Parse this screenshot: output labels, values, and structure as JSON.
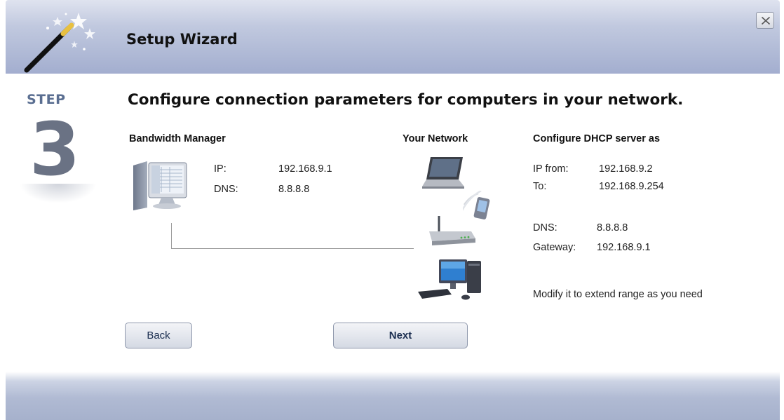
{
  "window": {
    "title": "Setup Wizard"
  },
  "step": {
    "label": "STEP",
    "number": "3"
  },
  "heading": "Configure connection parameters for computers in your network.",
  "bandwidth_manager": {
    "title": "Bandwidth Manager",
    "ip_label": "IP:",
    "ip_value": "192.168.9.1",
    "dns_label": "DNS:",
    "dns_value": "8.8.8.8"
  },
  "your_network": {
    "title": "Your Network"
  },
  "dhcp": {
    "title": "Configure DHCP server as",
    "ip_from_label": "IP from:",
    "ip_from_value": "192.168.9.2",
    "to_label": "To:",
    "to_value": "192.168.9.254",
    "dns_label": "DNS:",
    "dns_value": "8.8.8.8",
    "gateway_label": "Gateway:",
    "gateway_value": "192.168.9.1",
    "note": "Modify it to extend range as you need"
  },
  "buttons": {
    "back": "Back",
    "next": "Next"
  },
  "icons": [
    "magic-wand-icon",
    "close-icon",
    "server-computer-icon",
    "laptop-icon",
    "phone-icon",
    "router-icon",
    "desktop-pc-icon"
  ],
  "colors": {
    "header": "#a3aecf",
    "step_label": "#5a6e91",
    "step_number": "#6a7284",
    "button_text": "#1a2d4f"
  }
}
